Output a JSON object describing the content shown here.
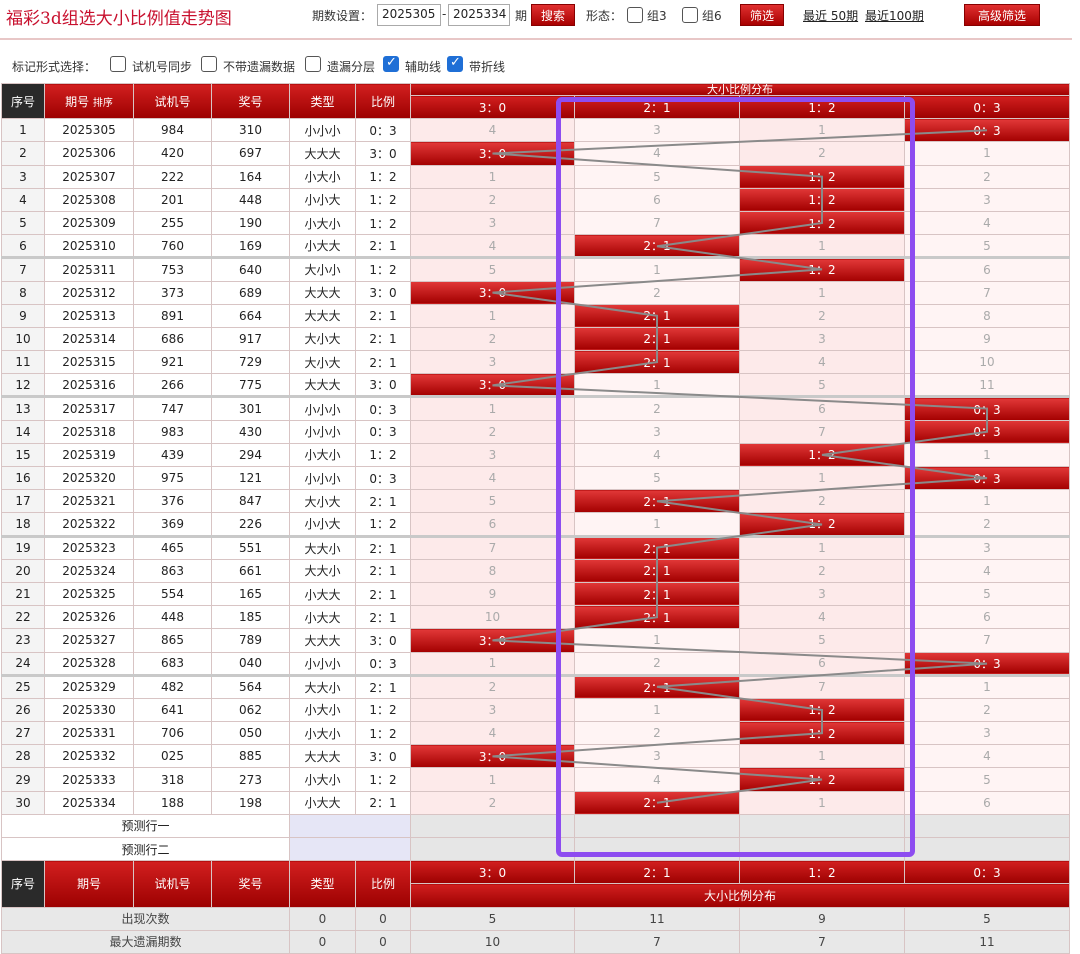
{
  "header": {
    "title": "福彩3d组选大小比例值走势图",
    "period_label": "期数设置：",
    "period_from": "2025305",
    "period_dash": "-",
    "period_to": "2025334",
    "period_unit": "期",
    "search_label": "搜索",
    "form_label": "形态：",
    "group3_label": "组3",
    "group6_label": "组6",
    "filter_label": "筛选",
    "recent50": "最近 50期",
    "recent100": "最近100期",
    "advanced_label": "高级筛选"
  },
  "options": {
    "label": "标记形式选择：",
    "items": [
      {
        "label": "试机号同步",
        "checked": false
      },
      {
        "label": "不带遗漏数据",
        "checked": false
      },
      {
        "label": "遗漏分层",
        "checked": false
      },
      {
        "label": "辅助线",
        "checked": true
      },
      {
        "label": "带折线",
        "checked": true
      }
    ]
  },
  "table": {
    "headers": {
      "seq": "序号",
      "period": "期号",
      "sort": "排序",
      "trial": "试机号",
      "prize": "奖号",
      "type": "类型",
      "ratio": "比例",
      "dist": "大小比例分布"
    },
    "dist_cols": [
      "3：0",
      "2：1",
      "1：2",
      "0：3"
    ],
    "rows": [
      {
        "seq": "1",
        "period": "2025305",
        "trial": "984",
        "prize": "310",
        "type": "小小小",
        "ratio": "0：3",
        "hit": 3,
        "miss": [
          "4",
          "3",
          "1",
          ""
        ]
      },
      {
        "seq": "2",
        "period": "2025306",
        "trial": "420",
        "prize": "697",
        "type": "大大大",
        "ratio": "3：0",
        "hit": 0,
        "miss": [
          "",
          "4",
          "2",
          "1"
        ]
      },
      {
        "seq": "3",
        "period": "2025307",
        "trial": "222",
        "prize": "164",
        "type": "小大小",
        "ratio": "1：2",
        "hit": 2,
        "miss": [
          "1",
          "5",
          "",
          "2"
        ]
      },
      {
        "seq": "4",
        "period": "2025308",
        "trial": "201",
        "prize": "448",
        "type": "小小大",
        "ratio": "1：2",
        "hit": 2,
        "miss": [
          "2",
          "6",
          "",
          "3"
        ]
      },
      {
        "seq": "5",
        "period": "2025309",
        "trial": "255",
        "prize": "190",
        "type": "小大小",
        "ratio": "1：2",
        "hit": 2,
        "miss": [
          "3",
          "7",
          "",
          "4"
        ]
      },
      {
        "seq": "6",
        "period": "2025310",
        "trial": "760",
        "prize": "169",
        "type": "小大大",
        "ratio": "2：1",
        "hit": 1,
        "miss": [
          "4",
          "",
          "1",
          "5"
        ]
      },
      {
        "seq": "7",
        "period": "2025311",
        "trial": "753",
        "prize": "640",
        "type": "大小小",
        "ratio": "1：2",
        "hit": 2,
        "miss": [
          "5",
          "1",
          "",
          "6"
        ]
      },
      {
        "seq": "8",
        "period": "2025312",
        "trial": "373",
        "prize": "689",
        "type": "大大大",
        "ratio": "3：0",
        "hit": 0,
        "miss": [
          "",
          "2",
          "1",
          "7"
        ]
      },
      {
        "seq": "9",
        "period": "2025313",
        "trial": "891",
        "prize": "664",
        "type": "大大大",
        "ratio": "2：1",
        "hit": 1,
        "miss": [
          "1",
          "",
          "2",
          "8"
        ]
      },
      {
        "seq": "10",
        "period": "2025314",
        "trial": "686",
        "prize": "917",
        "type": "大小大",
        "ratio": "2：1",
        "hit": 1,
        "miss": [
          "2",
          "",
          "3",
          "9"
        ]
      },
      {
        "seq": "11",
        "period": "2025315",
        "trial": "921",
        "prize": "729",
        "type": "大小大",
        "ratio": "2：1",
        "hit": 1,
        "miss": [
          "3",
          "",
          "4",
          "10"
        ]
      },
      {
        "seq": "12",
        "period": "2025316",
        "trial": "266",
        "prize": "775",
        "type": "大大大",
        "ratio": "3：0",
        "hit": 0,
        "miss": [
          "",
          "1",
          "5",
          "11"
        ]
      },
      {
        "seq": "13",
        "period": "2025317",
        "trial": "747",
        "prize": "301",
        "type": "小小小",
        "ratio": "0：3",
        "hit": 3,
        "miss": [
          "1",
          "2",
          "6",
          ""
        ]
      },
      {
        "seq": "14",
        "period": "2025318",
        "trial": "983",
        "prize": "430",
        "type": "小小小",
        "ratio": "0：3",
        "hit": 3,
        "miss": [
          "2",
          "3",
          "7",
          ""
        ]
      },
      {
        "seq": "15",
        "period": "2025319",
        "trial": "439",
        "prize": "294",
        "type": "小大小",
        "ratio": "1：2",
        "hit": 2,
        "miss": [
          "3",
          "4",
          "",
          "1"
        ]
      },
      {
        "seq": "16",
        "period": "2025320",
        "trial": "975",
        "prize": "121",
        "type": "小小小",
        "ratio": "0：3",
        "hit": 3,
        "miss": [
          "4",
          "5",
          "1",
          ""
        ]
      },
      {
        "seq": "17",
        "period": "2025321",
        "trial": "376",
        "prize": "847",
        "type": "大小大",
        "ratio": "2：1",
        "hit": 1,
        "miss": [
          "5",
          "",
          "2",
          "1"
        ]
      },
      {
        "seq": "18",
        "period": "2025322",
        "trial": "369",
        "prize": "226",
        "type": "小小大",
        "ratio": "1：2",
        "hit": 2,
        "miss": [
          "6",
          "1",
          "",
          "2"
        ]
      },
      {
        "seq": "19",
        "period": "2025323",
        "trial": "465",
        "prize": "551",
        "type": "大大小",
        "ratio": "2：1",
        "hit": 1,
        "miss": [
          "7",
          "",
          "1",
          "3"
        ]
      },
      {
        "seq": "20",
        "period": "2025324",
        "trial": "863",
        "prize": "661",
        "type": "大大小",
        "ratio": "2：1",
        "hit": 1,
        "miss": [
          "8",
          "",
          "2",
          "4"
        ]
      },
      {
        "seq": "21",
        "period": "2025325",
        "trial": "554",
        "prize": "165",
        "type": "小大大",
        "ratio": "2：1",
        "hit": 1,
        "miss": [
          "9",
          "",
          "3",
          "5"
        ]
      },
      {
        "seq": "22",
        "period": "2025326",
        "trial": "448",
        "prize": "185",
        "type": "小大大",
        "ratio": "2：1",
        "hit": 1,
        "miss": [
          "10",
          "",
          "4",
          "6"
        ]
      },
      {
        "seq": "23",
        "period": "2025327",
        "trial": "865",
        "prize": "789",
        "type": "大大大",
        "ratio": "3：0",
        "hit": 0,
        "miss": [
          "",
          "1",
          "5",
          "7"
        ]
      },
      {
        "seq": "24",
        "period": "2025328",
        "trial": "683",
        "prize": "040",
        "type": "小小小",
        "ratio": "0：3",
        "hit": 3,
        "miss": [
          "1",
          "2",
          "6",
          ""
        ]
      },
      {
        "seq": "25",
        "period": "2025329",
        "trial": "482",
        "prize": "564",
        "type": "大大小",
        "ratio": "2：1",
        "hit": 1,
        "miss": [
          "2",
          "",
          "7",
          "1"
        ]
      },
      {
        "seq": "26",
        "period": "2025330",
        "trial": "641",
        "prize": "062",
        "type": "小大小",
        "ratio": "1：2",
        "hit": 2,
        "miss": [
          "3",
          "1",
          "",
          "2"
        ]
      },
      {
        "seq": "27",
        "period": "2025331",
        "trial": "706",
        "prize": "050",
        "type": "小大小",
        "ratio": "1：2",
        "hit": 2,
        "miss": [
          "4",
          "2",
          "",
          "3"
        ]
      },
      {
        "seq": "28",
        "period": "2025332",
        "trial": "025",
        "prize": "885",
        "type": "大大大",
        "ratio": "3：0",
        "hit": 0,
        "miss": [
          "",
          "3",
          "1",
          "4"
        ]
      },
      {
        "seq": "29",
        "period": "2025333",
        "trial": "318",
        "prize": "273",
        "type": "小大小",
        "ratio": "1：2",
        "hit": 2,
        "miss": [
          "1",
          "4",
          "",
          "5"
        ]
      },
      {
        "seq": "30",
        "period": "2025334",
        "trial": "188",
        "prize": "198",
        "type": "小大大",
        "ratio": "2：1",
        "hit": 1,
        "miss": [
          "2",
          "",
          "1",
          "6"
        ]
      }
    ],
    "predict1": "预测行一",
    "predict2": "预测行二",
    "stats": [
      {
        "label": "出现次数",
        "type": "0",
        "ratio": "0",
        "vals": [
          "5",
          "11",
          "9",
          "5"
        ]
      },
      {
        "label": "最大遗漏期数",
        "type": "0",
        "ratio": "0",
        "vals": [
          "10",
          "7",
          "7",
          "11"
        ]
      }
    ]
  },
  "colors": {
    "accent": "#c8102e",
    "highlight_frame": "#8d4cf0"
  }
}
